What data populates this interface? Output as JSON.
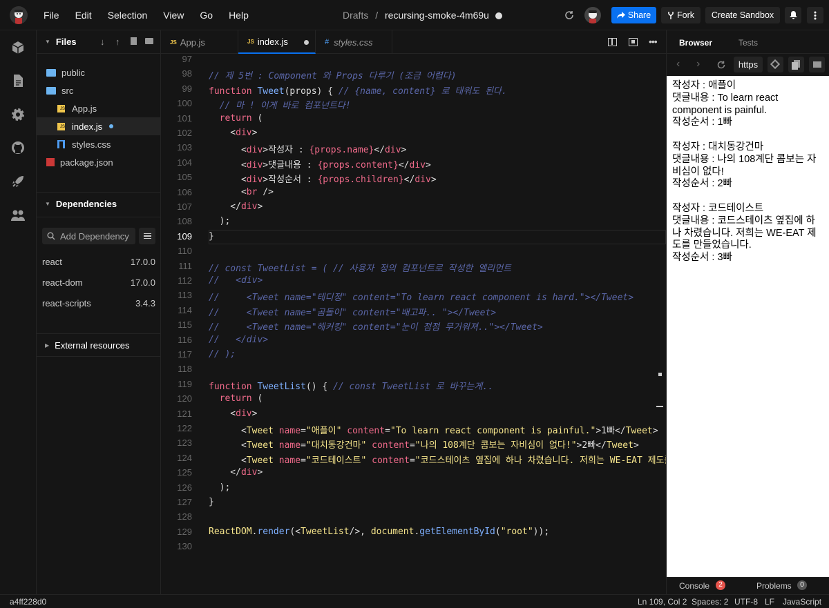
{
  "menu": [
    "File",
    "Edit",
    "Selection",
    "View",
    "Go",
    "Help"
  ],
  "breadcrumb": {
    "folder": "Drafts",
    "sep": "/",
    "name": "recursing-smoke-4m69u"
  },
  "topbar": {
    "share": "Share",
    "fork": "Fork",
    "create": "Create Sandbox"
  },
  "sidebar": {
    "files_title": "Files",
    "tree": [
      {
        "label": "public",
        "type": "folder"
      },
      {
        "label": "src",
        "type": "folder-open"
      },
      {
        "label": "App.js",
        "type": "js"
      },
      {
        "label": "index.js",
        "type": "js"
      },
      {
        "label": "styles.css",
        "type": "css"
      },
      {
        "label": "package.json",
        "type": "json"
      }
    ],
    "deps_title": "Dependencies",
    "add_dep_placeholder": "Add Dependency",
    "deps": [
      {
        "name": "react",
        "version": "17.0.0"
      },
      {
        "name": "react-dom",
        "version": "17.0.0"
      },
      {
        "name": "react-scripts",
        "version": "3.4.3"
      }
    ],
    "external_title": "External resources"
  },
  "tabs": [
    {
      "icon": "JS",
      "label": "App.js"
    },
    {
      "icon": "JS",
      "label": "index.js"
    },
    {
      "icon": "#",
      "label": "styles.css"
    }
  ],
  "code": {
    "lines": [
      97,
      98,
      99,
      100,
      101,
      102,
      103,
      104,
      105,
      106,
      107,
      108,
      109,
      110,
      111,
      112,
      113,
      114,
      115,
      116,
      117,
      118,
      119,
      120,
      121,
      122,
      123,
      124,
      125,
      126,
      127,
      128,
      129,
      130
    ],
    "current_line": 109
  },
  "right": {
    "tab_browser": "Browser",
    "tab_tests": "Tests",
    "url": "https",
    "console": "Console",
    "console_count": "2",
    "problems": "Problems",
    "problems_count": "0"
  },
  "preview": [
    [
      "작성자 : 애플이",
      "댓글내용 : To learn react component is painful.",
      "작성순서 : 1빠"
    ],
    [
      "작성자 : 대치동강건마",
      "댓글내용 : 나의 108계단 콤보는 자비심이 없다!",
      "작성순서 : 2빠"
    ],
    [
      "작성자 : 코드테이스트",
      "댓글내용 : 코드스테이츠 옆집에 하나 차렸습니다. 저희는 WE-EAT 제도를 만들었습니다.",
      "작성순서 : 3빠"
    ]
  ],
  "statusbar": {
    "commit": "a4ff228d0",
    "pos": "Ln 109, Col 2",
    "spaces": "Spaces: 2",
    "enc": "UTF-8",
    "eol": "LF",
    "lang": "JavaScript"
  }
}
